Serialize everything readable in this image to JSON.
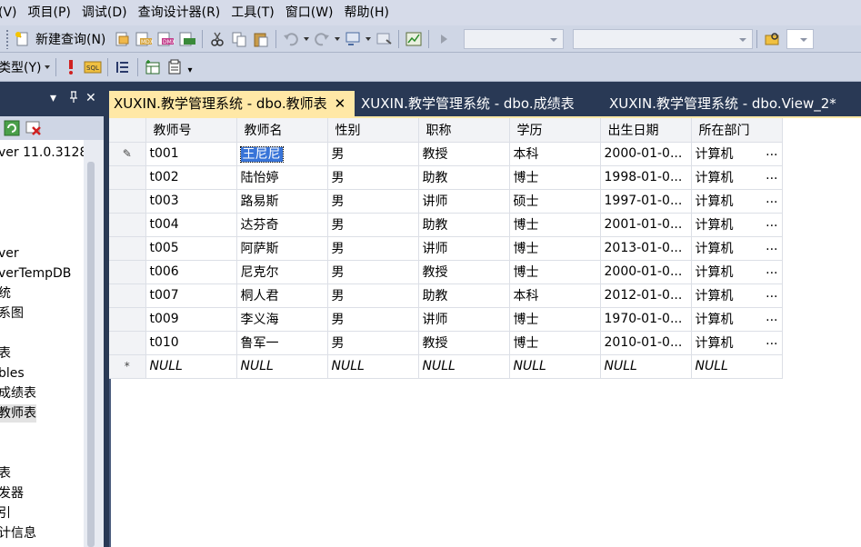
{
  "menu": [
    "(V)",
    "项目(P)",
    "调试(D)",
    "查询设计器(R)",
    "工具(T)",
    "窗口(W)",
    "帮助(H)"
  ],
  "toolbar1": {
    "new_query_label": "新建查询(N)",
    "icons": [
      "new-query-icon",
      "open-file-icon",
      "mdx-query-icon",
      "dmx-query-icon",
      "xmla-query-icon",
      "cut-icon",
      "copy-icon",
      "paste-icon",
      "undo-icon",
      "redo-icon",
      "navigate-icon",
      "properties-icon",
      "run-icon"
    ]
  },
  "toolbar2": {
    "change_type_label": "类型(Y)"
  },
  "left_panel": {
    "header_buttons": [
      "▾",
      "ᵖ",
      "✕"
    ],
    "tree": [
      "ver 11.0.3128",
      "ver",
      "verTempDB",
      "统",
      "系图",
      "表",
      "bles",
      "成绩表",
      "教师表",
      "表",
      "发器",
      "引",
      "计信息"
    ]
  },
  "tabs": [
    {
      "label": "XUXIN.教学管理系统 - dbo.教师表",
      "active": true,
      "close": "✕"
    },
    {
      "label": "XUXIN.教学管理系统 - dbo.成绩表",
      "active": false
    },
    {
      "label": "XUXIN.教学管理系统 - dbo.View_2*",
      "active": false
    }
  ],
  "grid": {
    "columns": [
      "教师号",
      "教师名",
      "性别",
      "职称",
      "学历",
      "出生日期",
      "所在部门"
    ],
    "row_markers": [
      "✎",
      "",
      "",
      "",
      "",
      "",
      "",
      "",
      "",
      "*"
    ],
    "rows": [
      [
        "t001",
        "王尼尼",
        "男",
        "教授",
        "本科",
        "2000-01-0...",
        "计算机",
        "..."
      ],
      [
        "t002",
        "陆怡婷",
        "男",
        "助教",
        "博士",
        "1998-01-0...",
        "计算机",
        "..."
      ],
      [
        "t003",
        "路易斯",
        "男",
        "讲师",
        "硕士",
        "1997-01-0...",
        "计算机",
        "..."
      ],
      [
        "t004",
        "达芬奇",
        "男",
        "助教",
        "博士",
        "2001-01-0...",
        "计算机",
        "..."
      ],
      [
        "t005",
        "阿萨斯",
        "男",
        "讲师",
        "博士",
        "2013-01-0...",
        "计算机",
        "..."
      ],
      [
        "t006",
        "尼克尔",
        "男",
        "教授",
        "博士",
        "2000-01-0...",
        "计算机",
        "..."
      ],
      [
        "t007",
        "桐人君",
        "男",
        "助教",
        "本科",
        "2012-01-0...",
        "计算机",
        "..."
      ],
      [
        "t009",
        "李义海",
        "男",
        "讲师",
        "博士",
        "1970-01-0...",
        "计算机",
        "..."
      ],
      [
        "t010",
        "鲁军一",
        "男",
        "教授",
        "博士",
        "2010-01-0...",
        "计算机",
        "..."
      ],
      [
        "NULL",
        "NULL",
        "NULL",
        "NULL",
        "NULL",
        "NULL",
        "NULL",
        ""
      ]
    ]
  },
  "colors": {
    "frame": "#293955",
    "menubar": "#d6dbe9",
    "toolbar": "#cfd6e5",
    "active_tab": "#ffe8a6",
    "selection": "#3874d8"
  }
}
